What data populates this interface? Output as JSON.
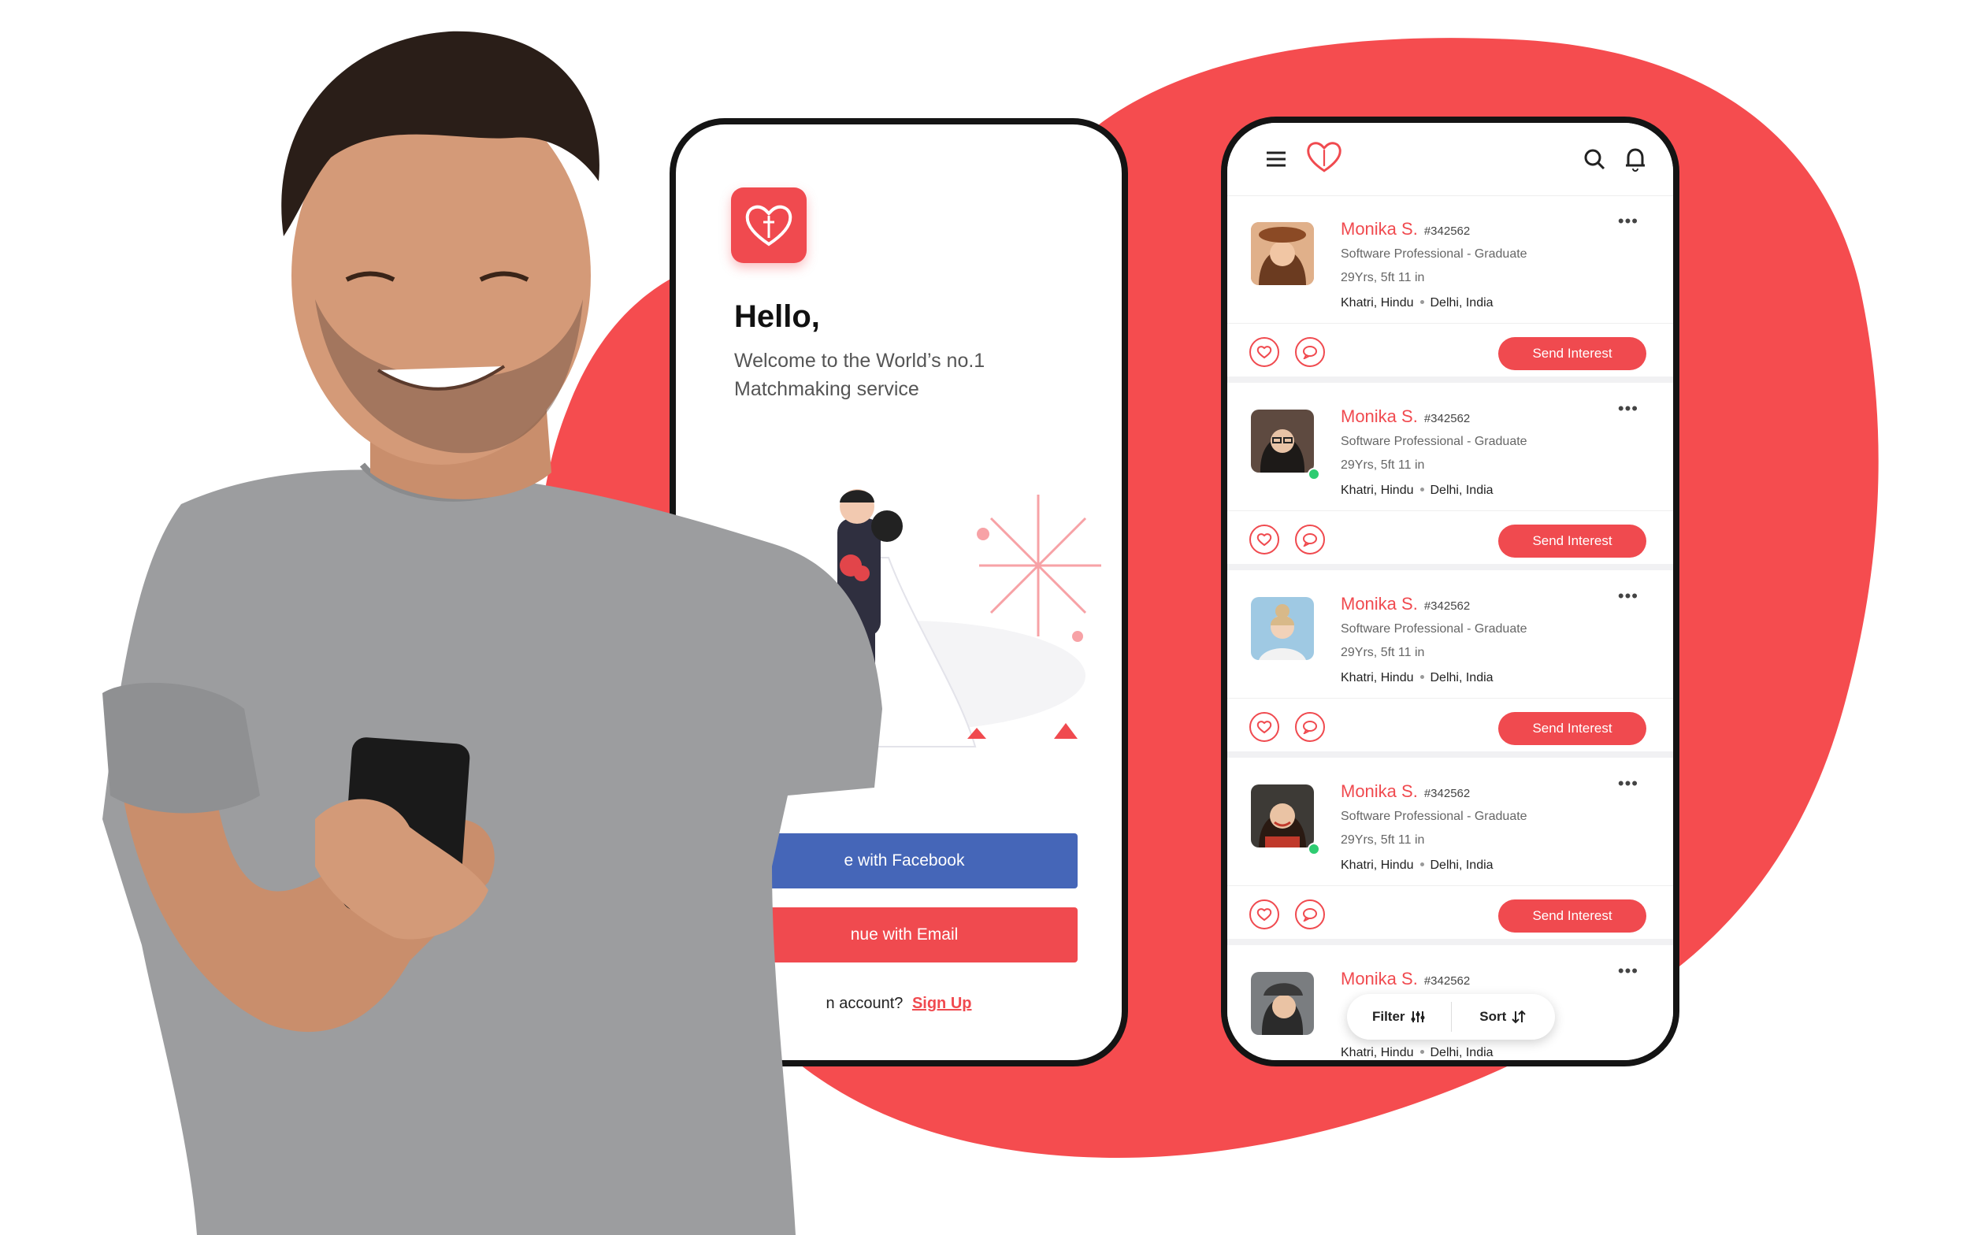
{
  "welcome_screen": {
    "greeting": "Hello,",
    "subtitle": "Welcome to the World’s no.1 Matchmaking service",
    "facebook_button": "e with Facebook",
    "email_button": "nue with Email",
    "signup_prompt": "n account?",
    "signup_link": "Sign Up"
  },
  "matches_screen": {
    "profiles": [
      {
        "name": "Monika S.",
        "id": "#342562",
        "profession": "Software Professional - Graduate",
        "age_height": "29Yrs, 5ft 11 in",
        "community": "Khatri, Hindu",
        "location": "Delhi, India",
        "online": false,
        "hair": "#6b3b20"
      },
      {
        "name": "Monika S.",
        "id": "#342562",
        "profession": "Software Professional - Graduate",
        "age_height": "29Yrs, 5ft 11 in",
        "community": "Khatri, Hindu",
        "location": "Delhi, India",
        "online": true,
        "hair": "#1d1a18"
      },
      {
        "name": "Monika S.",
        "id": "#342562",
        "profession": "Software Professional - Graduate",
        "age_height": "29Yrs, 5ft 11 in",
        "community": "Khatri, Hindu",
        "location": "Delhi, India",
        "online": false,
        "hair": "#d8b989"
      },
      {
        "name": "Monika S.",
        "id": "#342562",
        "profession": "Software Professional - Graduate",
        "age_height": "29Yrs, 5ft 11 in",
        "community": "Khatri, Hindu",
        "location": "Delhi, India",
        "online": true,
        "hair": "#2a1a12"
      }
    ],
    "partial_profile": {
      "name": "Monika S.",
      "id": "#342562",
      "community": "Khatri, Hindu",
      "location": "Delhi, India"
    },
    "send_interest_label": "Send Interest",
    "more_label": "•••",
    "filter_label": "Filter",
    "sort_label": "Sort"
  },
  "colors": {
    "accent": "#f04a4f",
    "facebook": "#4566b8",
    "background_blob": "#f54c4f"
  }
}
